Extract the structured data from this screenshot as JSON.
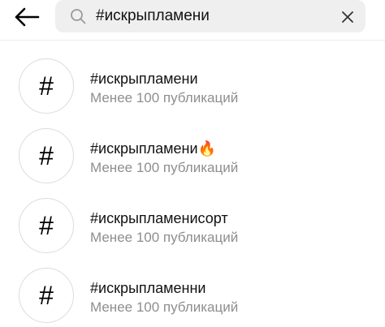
{
  "search": {
    "value": "#искрыпламени",
    "back_icon": "arrow-left-icon",
    "search_icon": "magnifier-icon",
    "clear_icon": "close-icon"
  },
  "results": [
    {
      "symbol": "#",
      "name": "#искрыпламени",
      "count": "Менее 100 публикаций"
    },
    {
      "symbol": "#",
      "name": "#искрыпламени🔥",
      "count": "Менее 100 публикаций"
    },
    {
      "symbol": "#",
      "name": "#искрыпламенисорт",
      "count": "Менее 100 публикаций"
    },
    {
      "symbol": "#",
      "name": "#искрыпламенни",
      "count": "Менее 100 публикаций"
    }
  ],
  "colors": {
    "search_bg": "#efefef",
    "secondary_text": "#8e8e8e",
    "circle_border": "#dcdcdc"
  }
}
